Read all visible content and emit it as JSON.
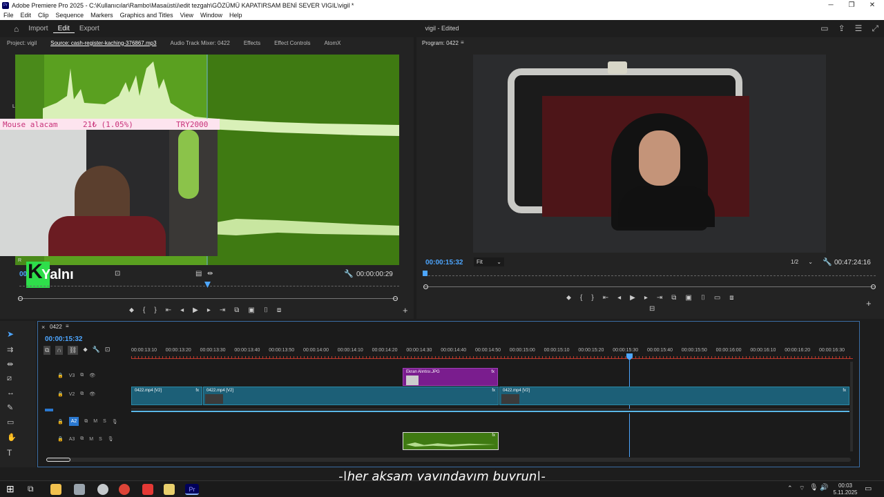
{
  "window": {
    "title": "Adobe Premiere Pro 2025 - C:\\Kullanıcılar\\Rambo\\Masaüstü\\edit tezgah\\GÖZÜMÜ KAPATIRSAM BENİ SEVER VIGIL\\vigil *",
    "app_badge": "Pr",
    "controls": {
      "minimize": "─",
      "restore": "❐",
      "close": "✕"
    }
  },
  "menu": [
    "File",
    "Edit",
    "Clip",
    "Sequence",
    "Markers",
    "Graphics and Titles",
    "View",
    "Window",
    "Help"
  ],
  "header": {
    "home_icon": "home-icon",
    "nav": [
      "Import",
      "Edit",
      "Export"
    ],
    "active_nav": "Edit",
    "project_status": "vigil - Edited"
  },
  "source_panel": {
    "tabs": [
      "Project: vigil",
      "Source: cash-register-kaching-376867.mp3",
      "Audio Track Mixer: 0422",
      "Effects",
      "Effect Controls",
      "AtomX"
    ],
    "active_tab": "Source: cash-register-kaching-376867.mp3",
    "channel_left": "L",
    "channel_right": "R",
    "timecode_left": "00",
    "duration": "00:00:00:29",
    "waveform_color": "#3f7a12"
  },
  "overlay": {
    "donation_text": "Mouse alacam",
    "donation_amount": "21₺ (1.05%)",
    "donation_goal": "TRY2000",
    "logo_letter": "K",
    "logo_text": "Yalnı"
  },
  "program_panel": {
    "title": "Program: 0422",
    "timecode": "00:00:15:32",
    "fit_option": "Fit",
    "resolution": "1/2",
    "duration": "00:47:24:16"
  },
  "timeline": {
    "sequence_name": "0422",
    "timecode": "00:00:15:32",
    "ruler": [
      "00:00:13:10",
      "00:00:13:20",
      "00:00:13:30",
      "00:00:13:40",
      "00:00:13:50",
      "00:00:14:00",
      "00:00:14:10",
      "00:00:14:20",
      "00:00:14:30",
      "00:00:14:40",
      "00:00:14:50",
      "00:00:15:00",
      "00:00:15:10",
      "00:00:15:20",
      "00:00:15:30",
      "00:00:15:40",
      "00:00:15:50",
      "00:00:16:00",
      "00:00:16:10",
      "00:00:16:20",
      "00:00:16:30"
    ],
    "tracks": {
      "v3": "V3",
      "v2": "V2",
      "a2": "A2",
      "a3": "A3",
      "m": "M",
      "s": "S"
    },
    "clips": {
      "graphic": "Ekran Alıntısı.JPG",
      "video_1": "0422.mp4 [V2]",
      "video_2": "0422.mp4 [V2]",
      "video_3": "0422.mp4 [V2]",
      "fx": "fx"
    },
    "clip_colors": {
      "video": "#1c5f77",
      "graphic": "#7a1d8e",
      "audio": "#3f7a12"
    }
  },
  "subtitle": "-|her akşam yayındayım buyrun|-",
  "taskbar": {
    "time": "00:03",
    "date": "5.11.2025"
  }
}
